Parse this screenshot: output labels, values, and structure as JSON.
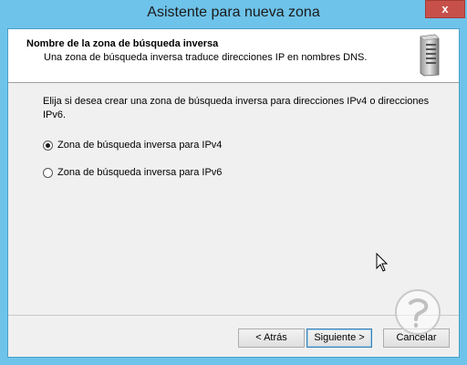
{
  "window": {
    "title": "Asistente para nueva zona",
    "close_glyph": "x"
  },
  "header": {
    "title": "Nombre de la zona de búsqueda inversa",
    "subtitle": "Una zona de búsqueda inversa traduce direcciones IP en nombres DNS."
  },
  "body": {
    "instruction": "Elija si desea crear una zona de búsqueda inversa para direcciones IPv4 o direcciones IPv6.",
    "options": [
      {
        "label": "Zona de búsqueda inversa para IPv4",
        "checked": true
      },
      {
        "label": "Zona de búsqueda inversa para IPv6",
        "checked": false
      }
    ]
  },
  "buttons": {
    "back": "< Atrás",
    "next": "Siguiente >",
    "cancel": "Cancelar"
  },
  "icons": [
    "server-icon",
    "close-icon",
    "mouse-cursor-icon",
    "watermark-logo-icon"
  ],
  "colors": {
    "titlebar": "#6ec3ea",
    "close": "#c7504b",
    "dialog": "#f0f0f0"
  }
}
